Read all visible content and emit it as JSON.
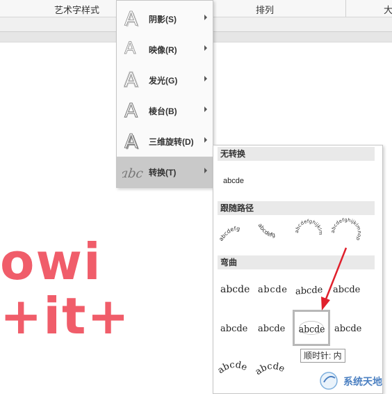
{
  "ribbon": {
    "group1": "艺术字样式",
    "group2": "排列",
    "group3": "大"
  },
  "canvas": {
    "line1": "owi",
    "line2": "+it+"
  },
  "effects_menu": {
    "items": [
      {
        "label": "阴影(S)",
        "icon": "shadow-a-icon"
      },
      {
        "label": "映像(R)",
        "icon": "reflection-a-icon"
      },
      {
        "label": "发光(G)",
        "icon": "glow-a-icon"
      },
      {
        "label": "棱台(B)",
        "icon": "bevel-a-icon"
      },
      {
        "label": "三维旋转(D)",
        "icon": "3d-rotation-a-icon"
      },
      {
        "label": "转换(T)",
        "icon": "transform-abc-icon"
      }
    ],
    "active_index": 5
  },
  "transform_gallery": {
    "sections": {
      "no_transform": "无转换",
      "follow_path": "跟随路径",
      "warp": "弯曲"
    },
    "no_transform_sample": "abcde",
    "follow_path_samples": [
      "abcdefg",
      "abcdefg",
      "abcdefghijklm",
      "abcdefghijklmnop"
    ],
    "warp_samples": [
      "abcde",
      "abcde",
      "abcde",
      "abcde",
      "abcde",
      "abcde",
      "abcde",
      "abcde",
      "abcde",
      "abcde"
    ],
    "selected_warp_index": 6,
    "tooltip": "顺时针: 内"
  },
  "watermark": {
    "text": "系统天地"
  },
  "colors": {
    "wordart_red": "#f05d6a",
    "annotation_arrow": "#e0202c",
    "menu_active": "#c9c9c9"
  }
}
